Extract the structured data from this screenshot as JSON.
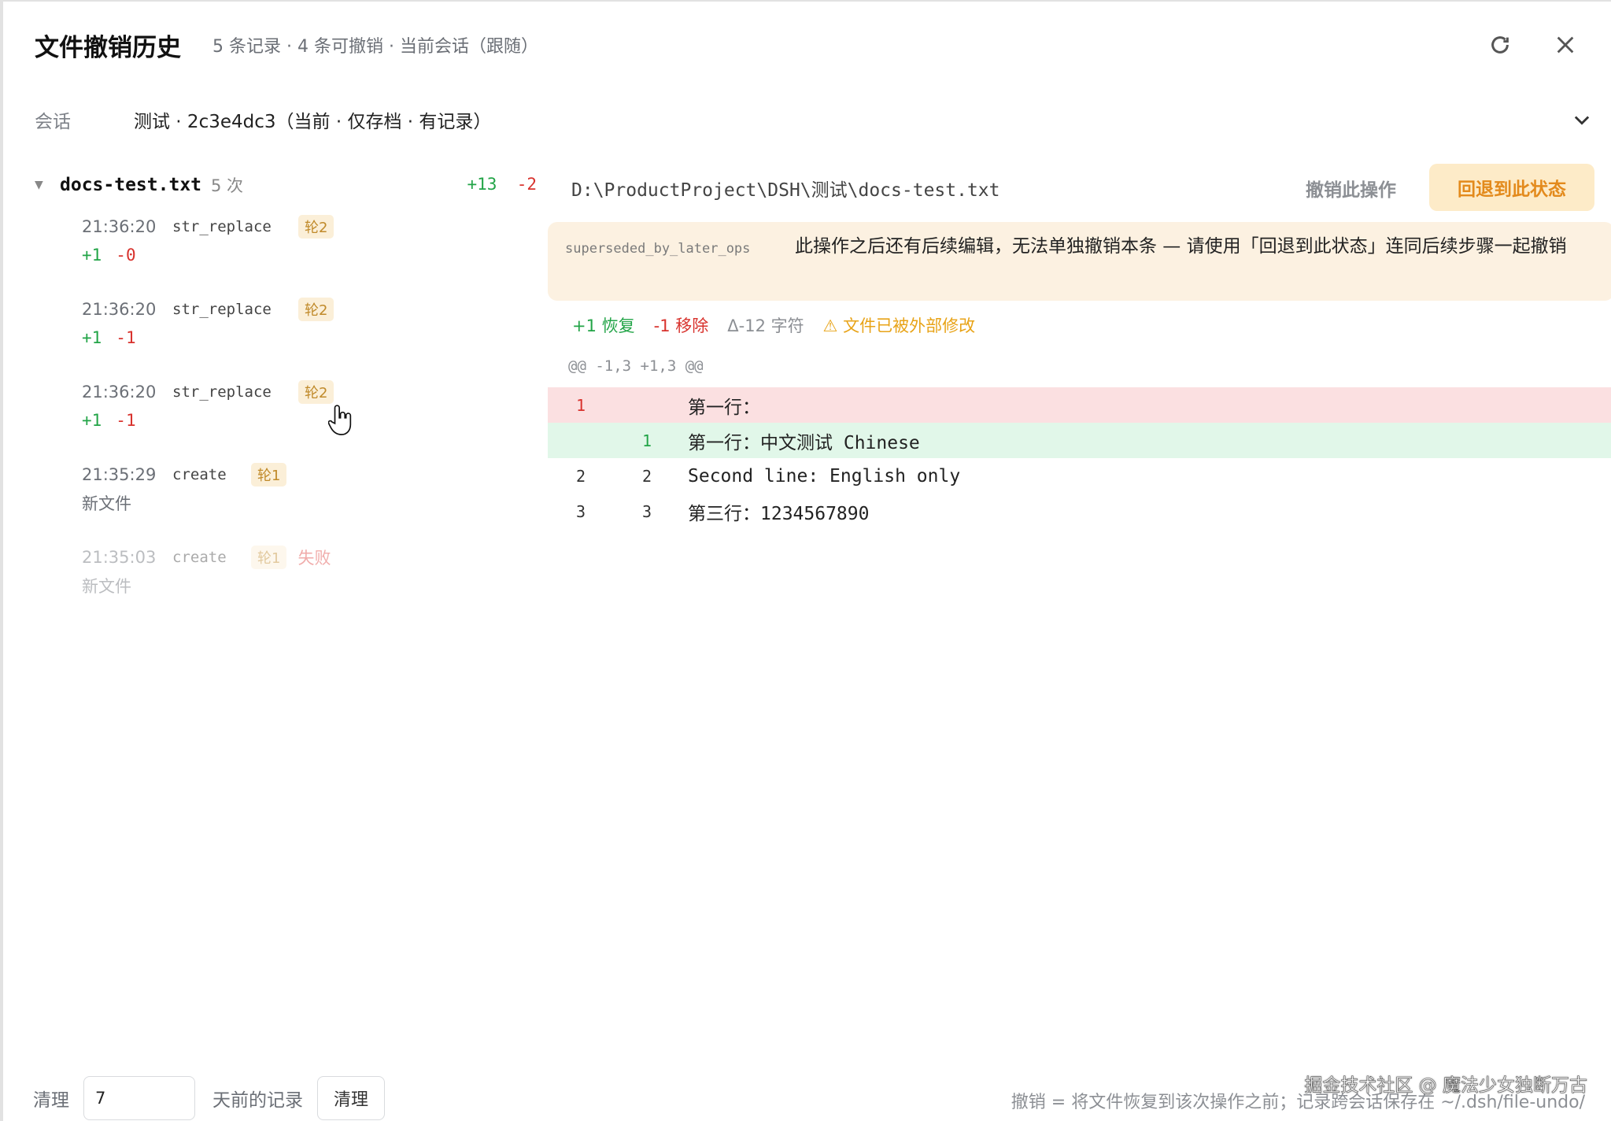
{
  "header": {
    "title": "文件撤销历史",
    "subtitle": "5 条记录 · 4 条可撤销 · 当前会话（跟随）"
  },
  "session": {
    "label": "会话",
    "value": "测试 · 2c3e4dc3（当前 · 仅存档 · 有记录）"
  },
  "file": {
    "name": "docs-test.txt",
    "count": "5 次",
    "plus": "+13",
    "minus": "-2"
  },
  "ops": [
    {
      "time": "21:36:20",
      "kind": "str_replace",
      "badge": "轮2",
      "plus": "+1",
      "minus": "-0"
    },
    {
      "time": "21:36:20",
      "kind": "str_replace",
      "badge": "轮2",
      "plus": "+1",
      "minus": "-1"
    },
    {
      "time": "21:36:20",
      "kind": "str_replace",
      "badge": "轮2",
      "plus": "+1",
      "minus": "-1"
    },
    {
      "time": "21:35:29",
      "kind": "create",
      "badge": "轮1",
      "note": "新文件"
    },
    {
      "time": "21:35:03",
      "kind": "create",
      "badge": "轮1",
      "status": "失败",
      "note": "新文件"
    }
  ],
  "detail": {
    "path": "D:\\ProductProject\\DSH\\测试\\docs-test.txt",
    "undo_label": "撤销此操作",
    "rollback_label": "回退到此状态",
    "notice_code": "superseded_by_later_ops",
    "notice_text": "此操作之后还有后续编辑，无法单独撤销本条 — 请使用「回退到此状态」连同后续步骤一起撤销",
    "restore": "+1 恢复",
    "remove": "-1 移除",
    "delta": "Δ-12 字符",
    "warning": "⚠ 文件已被外部修改",
    "hunk": "@@ -1,3 +1,3 @@",
    "lines": [
      {
        "old": "1",
        "new": "",
        "text": "第一行："
      },
      {
        "old": "",
        "new": "1",
        "text": "第一行：中文测试 Chinese"
      },
      {
        "old": "2",
        "new": "2",
        "text": "Second line: English only"
      },
      {
        "old": "3",
        "new": "3",
        "text": "第三行：1234567890"
      }
    ]
  },
  "footer": {
    "clean_label": "清理",
    "days_value": "7",
    "days_suffix": "天前的记录",
    "clean_button": "清理",
    "hint": "撤销 = 将文件恢复到该次操作之前；记录跨会话保存在 ~/.dsh/file-undo/",
    "watermark": "掘金技术社区 @ 魔法少女独断万古"
  },
  "colors": {
    "plus": "#22a447",
    "minus": "#d8322d",
    "accent": "#e38a1c",
    "warning": "#e8a317",
    "del_bg": "#fbe0e1",
    "add_bg": "#e1f7e9"
  },
  "icons": [
    "refresh-icon",
    "close-icon",
    "chevron-down-icon",
    "caret-down-icon",
    "hand-cursor-icon"
  ]
}
